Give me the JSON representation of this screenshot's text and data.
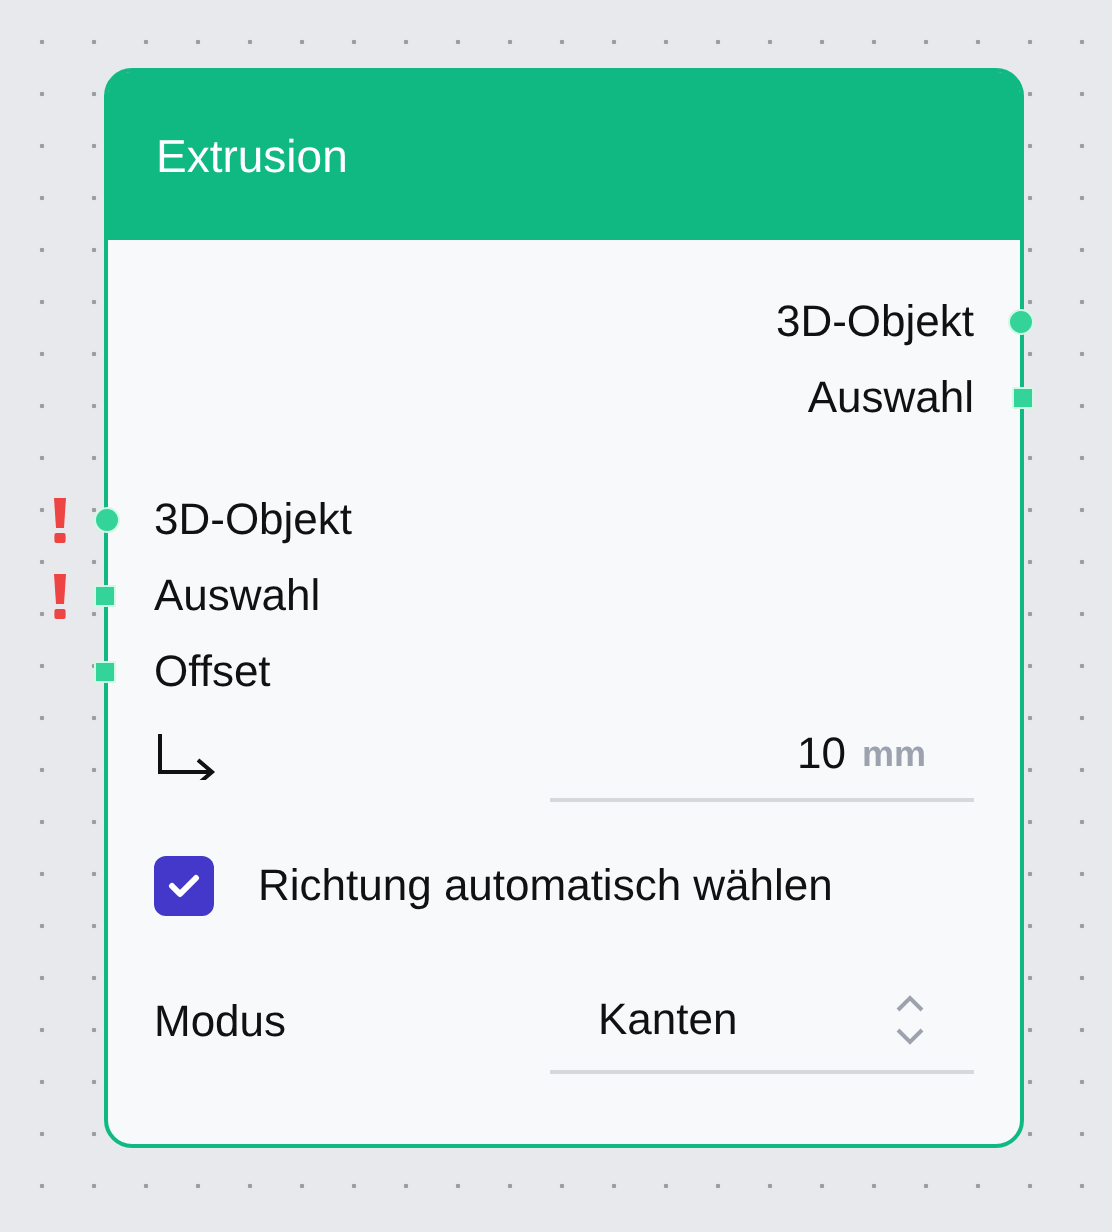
{
  "node": {
    "title": "Extrusion",
    "outputs": [
      {
        "label": "3D-Objekt",
        "kind": "circle"
      },
      {
        "label": "Auswahl",
        "kind": "square"
      }
    ],
    "inputs": [
      {
        "label": "3D-Objekt",
        "kind": "circle",
        "error": true
      },
      {
        "label": "Auswahl",
        "kind": "square",
        "error": true
      },
      {
        "label": "Offset",
        "kind": "square",
        "error": false
      }
    ],
    "offset": {
      "value": "10",
      "unit": "mm"
    },
    "checkbox": {
      "label": "Richtung automatisch wählen",
      "checked": true
    },
    "mode": {
      "label": "Modus",
      "value": "Kanten"
    }
  }
}
